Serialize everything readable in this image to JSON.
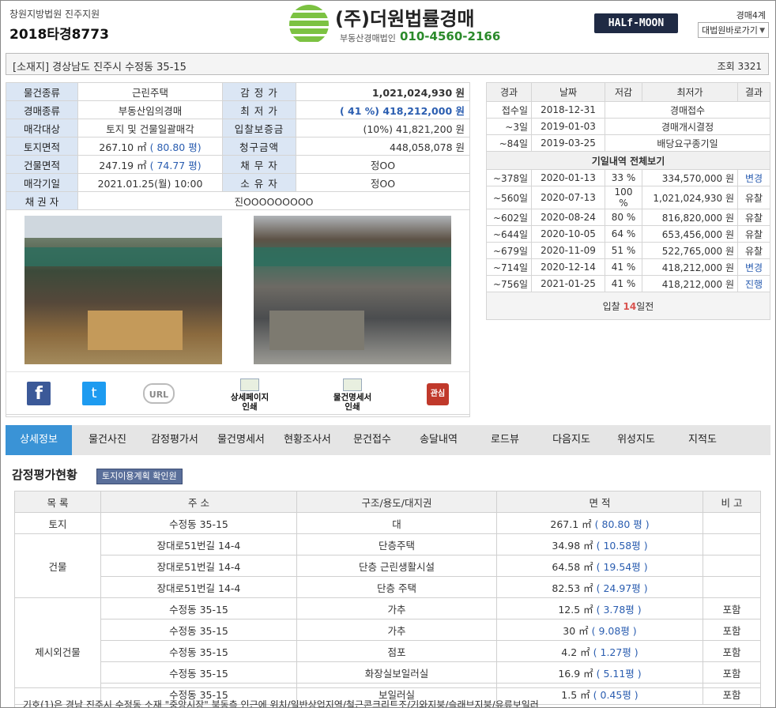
{
  "header": {
    "court": "창원지방법원 진주지원",
    "case_no": "2018타경8773",
    "logo_name": "(주)더원법률경매",
    "logo_sub": "부동산경매법인",
    "logo_tel": "010-4560-2166",
    "brand_badge": "HALf-MOON",
    "dept": "경매4계",
    "shortcut_label": "대법원바로가기"
  },
  "address_bar": {
    "address": "[소재지] 경상남도 진주시 수정동 35-15",
    "views": "조회 3321"
  },
  "info": {
    "type_label": "물건종류",
    "type_value": "근린주택",
    "appraise_label": "감 정 가",
    "appraise_value": "1,021,024,930 원",
    "auction_kind_label": "경매종류",
    "auction_kind_value": "부동산임의경매",
    "min_label": "최 저 가",
    "min_value": "( 41 %) 418,212,000 원",
    "target_label": "매각대상",
    "target_value": "토지 및 건물일괄매각",
    "deposit_label": "입찰보증금",
    "deposit_value": "(10%) 41,821,200 원",
    "land_label": "토지면적",
    "land_value": "267.10 ㎡",
    "land_pyeong": "( 80.80 평)",
    "claim_label": "청구금액",
    "claim_value": "448,058,078 원",
    "bldg_label": "건물면적",
    "bldg_value": "247.19 ㎡",
    "bldg_pyeong": "( 74.77 평)",
    "debtor_label": "채 무 자",
    "debtor_value": "정OO",
    "date_label": "매각기일",
    "date_value": "2021.01.25(월) 10:00",
    "owner_label": "소 유 자",
    "owner_value": "정OO",
    "creditor_label": "채 권 자",
    "creditor_value": "진OOOOOOOOO"
  },
  "share": {
    "fb": "f",
    "tw": "t",
    "url": "URL",
    "print_detail": [
      "상세페이지",
      "인쇄"
    ],
    "print_spec": [
      "물건명세서",
      "인쇄"
    ],
    "favorite": "관심"
  },
  "history": {
    "headers": [
      "경과",
      "날짜",
      "저감",
      "최저가",
      "결과"
    ],
    "pre_rows": [
      {
        "day": "접수일",
        "date": "2018-12-31",
        "desc": "경매접수"
      },
      {
        "day": "~3일",
        "date": "2019-01-03",
        "desc": "경매개시결정"
      },
      {
        "day": "~84일",
        "date": "2019-03-25",
        "desc": "배당요구종기일"
      }
    ],
    "bid_title": "기일내역 전체보기",
    "bid_rows": [
      {
        "day": "~378일",
        "date": "2020-01-13",
        "pct": "33 %",
        "price": "334,570,000 원",
        "result": "변경"
      },
      {
        "day": "~560일",
        "date": "2020-07-13",
        "pct": "100 %",
        "price": "1,021,024,930 원",
        "result": "유찰"
      },
      {
        "day": "~602일",
        "date": "2020-08-24",
        "pct": "80 %",
        "price": "816,820,000 원",
        "result": "유찰"
      },
      {
        "day": "~644일",
        "date": "2020-10-05",
        "pct": "64 %",
        "price": "653,456,000 원",
        "result": "유찰"
      },
      {
        "day": "~679일",
        "date": "2020-11-09",
        "pct": "51 %",
        "price": "522,765,000 원",
        "result": "유찰"
      },
      {
        "day": "~714일",
        "date": "2020-12-14",
        "pct": "41 %",
        "price": "418,212,000 원",
        "result": "변경"
      },
      {
        "day": "~756일",
        "date": "2021-01-25",
        "pct": "41 %",
        "price": "418,212,000 원",
        "result": "진행"
      }
    ],
    "dday_prefix": "입찰 ",
    "dday_num": "14",
    "dday_suffix": "일전"
  },
  "tabs": [
    "상세정보",
    "물건사진",
    "감정평가서",
    "물건명세서",
    "현황조사서",
    "문건접수",
    "송달내역",
    "로드뷰",
    "다음지도",
    "위성지도",
    "지적도"
  ],
  "appraisal": {
    "title": "감정평가현황",
    "land_plan_btn": "토지이용계획 확인원",
    "headers": [
      "목 록",
      "주 소",
      "구조/용도/대지권",
      "면 적",
      "비 고"
    ],
    "groups": [
      {
        "category": "토지",
        "rows": [
          {
            "addr": "수정동 35-15",
            "use": "대",
            "area": "267.1 ㎡",
            "pyeong": "( 80.80 평 )",
            "note": ""
          }
        ]
      },
      {
        "category": "건물",
        "rows": [
          {
            "addr": "장대로51번길 14-4",
            "use": "단층주택",
            "area": "34.98 ㎡",
            "pyeong": "( 10.58평 )",
            "note": ""
          },
          {
            "addr": "장대로51번길 14-4",
            "use": "단층 근린생활시설",
            "area": "64.58 ㎡",
            "pyeong": "( 19.54평 )",
            "note": ""
          },
          {
            "addr": "장대로51번길 14-4",
            "use": "단층 주택",
            "area": "82.53 ㎡",
            "pyeong": "( 24.97평 )",
            "note": ""
          }
        ]
      },
      {
        "category": "제시외건물",
        "rows": [
          {
            "addr": "수정동 35-15",
            "use": "가추",
            "area": "12.5 ㎡",
            "pyeong": "( 3.78평 )",
            "note": "포함"
          },
          {
            "addr": "수정동 35-15",
            "use": "가추",
            "area": "30 ㎡",
            "pyeong": "( 9.08평 )",
            "note": "포함"
          },
          {
            "addr": "수정동 35-15",
            "use": "점포",
            "area": "4.2 ㎡",
            "pyeong": "( 1.27평 )",
            "note": "포함"
          },
          {
            "addr": "수정동 35-15",
            "use": "화장실보일러실",
            "area": "16.9 ㎡",
            "pyeong": "( 5.11평 )",
            "note": "포함"
          },
          {
            "addr": "수정동 35-15",
            "use": "보일러실",
            "area": "1.5 ㎡",
            "pyeong": "( 0.45평 )",
            "note": "포함"
          }
        ]
      }
    ],
    "note": "기호(1)은 경남 진주시 수정동 소재 \"중앙시장\" 북동측 인근에 위치/일반상업지역/철근콘크리트조/기와지붕/슬래브지붕/유류보일러"
  },
  "colors": {
    "accent": "#3a93d6",
    "label_bg": "#dbe6f4",
    "link_blue": "#2a5db0",
    "dday_red": "#d9534f"
  }
}
